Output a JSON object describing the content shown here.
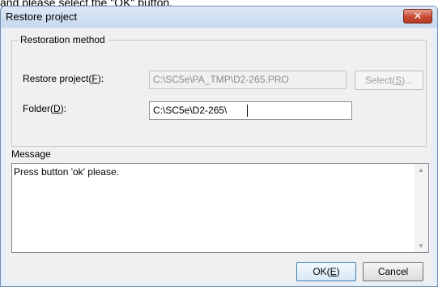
{
  "caption": {
    "text": "and please select the \"OK\" button."
  },
  "dialog": {
    "title": "Restore project",
    "close_glyph": "✕",
    "restoration_group": {
      "label": "Restoration method"
    },
    "restore_project": {
      "label_main": "Restore project(",
      "label_key": "F",
      "label_end": "):",
      "value": "C:\\SC5e\\PA_TMP\\D2-265.PRO",
      "select_main": "Select(",
      "select_key": "S",
      "select_end": ")..."
    },
    "folder": {
      "label_main": "Folder(",
      "label_key": "D",
      "label_end": "):",
      "value": "C:\\SC5e\\D2-265\\"
    },
    "message": {
      "label": "Message",
      "text": "Press button 'ok' please."
    },
    "ok_button": {
      "main": "OK(",
      "key": "E",
      "end": ")"
    },
    "cancel_button": {
      "label": "Cancel"
    }
  }
}
